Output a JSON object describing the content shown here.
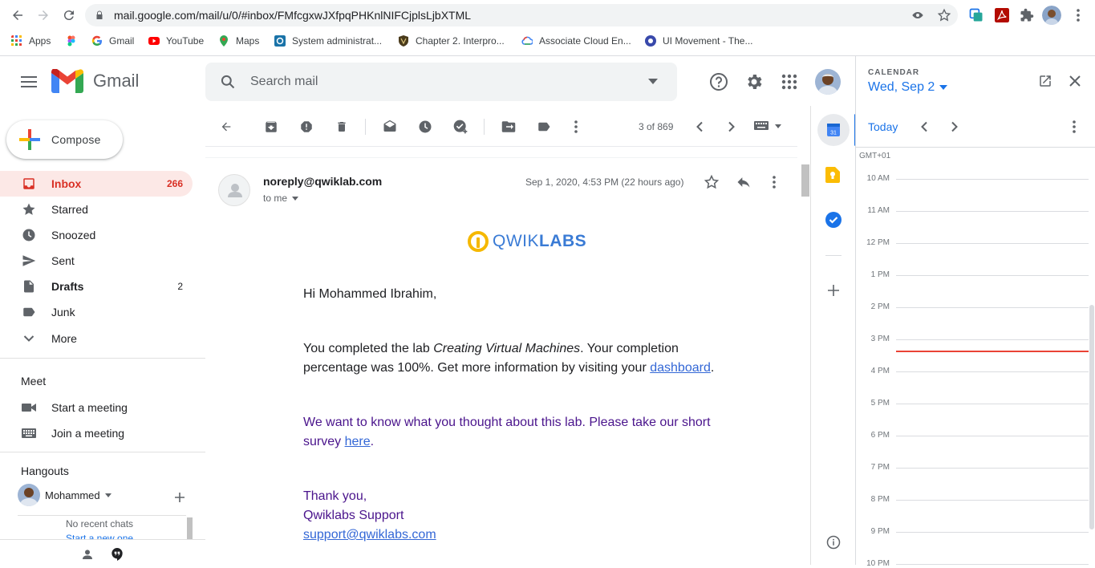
{
  "browser": {
    "url": "mail.google.com/mail/u/0/#inbox/FMfcgxwJXfpqPHKnlNIFCjplsLjbXTML",
    "bookmarks": [
      {
        "label": "Apps",
        "icon": "apps-grid-icon",
        "color": "#ea4335"
      },
      {
        "label": "",
        "icon": "figma-icon",
        "color": "#f24e1e"
      },
      {
        "label": "Gmail",
        "icon": "google-icon",
        "color": "#4285f4"
      },
      {
        "label": "YouTube",
        "icon": "youtube-icon",
        "color": "#ff0000"
      },
      {
        "label": "Maps",
        "icon": "maps-icon",
        "color": "#34a853"
      },
      {
        "label": "System administrat...",
        "icon": "coursera-icon",
        "color": "#1a73a8"
      },
      {
        "label": "Chapter 2. Interpro...",
        "icon": "shield-icon",
        "color": "#4a3b1c"
      },
      {
        "label": "Associate Cloud En...",
        "icon": "google-cloud-icon",
        "color": "#4285f4"
      },
      {
        "label": "UI Movement - The...",
        "icon": "uimovement-icon",
        "color": "#3949ab"
      }
    ]
  },
  "header": {
    "app_name": "Gmail",
    "search_placeholder": "Search mail"
  },
  "sidebar": {
    "compose_label": "Compose",
    "items": [
      {
        "label": "Inbox",
        "count": "266",
        "icon": "inbox-icon"
      },
      {
        "label": "Starred",
        "count": "",
        "icon": "star-icon"
      },
      {
        "label": "Snoozed",
        "count": "",
        "icon": "clock-icon"
      },
      {
        "label": "Sent",
        "count": "",
        "icon": "send-icon"
      },
      {
        "label": "Drafts",
        "count": "2",
        "icon": "draft-icon"
      },
      {
        "label": "Junk",
        "count": "",
        "icon": "label-icon"
      },
      {
        "label": "More",
        "count": "",
        "icon": "chevron-down-icon"
      }
    ],
    "meet": {
      "title": "Meet",
      "start": "Start a meeting",
      "join": "Join a meeting"
    },
    "hangouts": {
      "title": "Hangouts",
      "user": "Mohammed",
      "no_chats": "No recent chats",
      "start_new": "Start a new one"
    }
  },
  "toolbar": {
    "pagination": "3 of 869"
  },
  "email": {
    "sender": "noreply@qwiklab.com",
    "to": "to me",
    "date": "Sep 1, 2020, 4:53 PM (22 hours ago)",
    "logo_qwik": "QWIK",
    "logo_labs": "LABS",
    "greeting": "Hi Mohammed Ibrahim,",
    "p1_a": "You completed the lab ",
    "p1_italic": "Creating Virtual Machines",
    "p1_b": ". Your completion",
    "p1_c": "percentage was 100%. Get more information by visiting your ",
    "p1_link": "dashboard",
    "p1_end": ".",
    "p2_a": "We want to know what you thought about this lab. Please take our short",
    "p2_b": "survey ",
    "p2_link": "here",
    "p2_end": ".",
    "signoff": "Thank you,",
    "team": "Qwiklabs Support",
    "support_link": "support@qwiklabs.com"
  },
  "calendar": {
    "label": "CALENDAR",
    "date": "Wed, Sep 2",
    "today": "Today",
    "timezone": "GMT+01",
    "hours": [
      "10 AM",
      "11 AM",
      "12 PM",
      "1 PM",
      "2 PM",
      "3 PM",
      "4 PM",
      "5 PM",
      "6 PM",
      "7 PM",
      "8 PM",
      "9 PM",
      "10 PM"
    ],
    "current_time_fraction_of_hour_after_3pm": 0.35,
    "now_line_color": "#ea4335"
  }
}
